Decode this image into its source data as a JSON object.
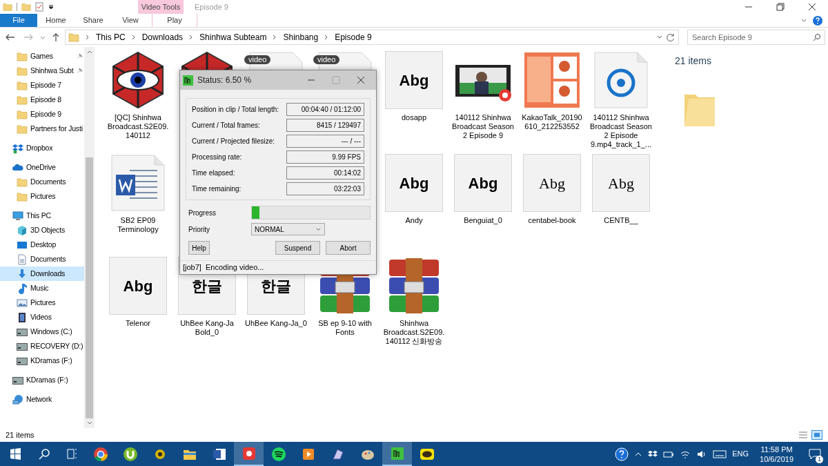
{
  "window": {
    "title": "Episode 9",
    "context_tab_group": "Video Tools"
  },
  "ribbon_tabs": [
    {
      "label": "File",
      "selected": true,
      "kind": "file"
    },
    {
      "label": "Home",
      "selected": false,
      "kind": "tab"
    },
    {
      "label": "Share",
      "selected": false,
      "kind": "tab"
    },
    {
      "label": "View",
      "selected": false,
      "kind": "tab"
    },
    {
      "label": "Play",
      "selected": false,
      "kind": "context"
    }
  ],
  "address_bar": {
    "path": [
      "This PC",
      "Downloads",
      "Shinhwa Subteam",
      "Shinbang",
      "Episode 9"
    ]
  },
  "search": {
    "placeholder": "Search Episode 9"
  },
  "sidebar": {
    "quick_access": [
      {
        "label": "Games",
        "pinned": true
      },
      {
        "label": "Shinhwa Subt",
        "pinned": true
      },
      {
        "label": "Episode 7",
        "pinned": false
      },
      {
        "label": "Episode 8",
        "pinned": false
      },
      {
        "label": "Episode 9",
        "pinned": false
      },
      {
        "label": "Partners for Justi",
        "pinned": false
      }
    ],
    "items": [
      {
        "label": "Dropbox",
        "kind": "dropbox",
        "selected": false
      },
      {
        "label": "OneDrive",
        "kind": "cloud",
        "selected": false,
        "children": [
          {
            "label": "Documents",
            "kind": "folder",
            "selected": false
          },
          {
            "label": "Pictures",
            "kind": "folder",
            "selected": false
          }
        ]
      },
      {
        "label": "This PC",
        "kind": "pc",
        "selected": false,
        "children": [
          {
            "label": "3D Objects",
            "kind": "cube",
            "selected": false
          },
          {
            "label": "Desktop",
            "kind": "desktop",
            "selected": false
          },
          {
            "label": "Documents",
            "kind": "document",
            "selected": false
          },
          {
            "label": "Downloads",
            "kind": "download",
            "selected": true
          },
          {
            "label": "Music",
            "kind": "music",
            "selected": false
          },
          {
            "label": "Pictures",
            "kind": "pictures",
            "selected": false
          },
          {
            "label": "Videos",
            "kind": "videos",
            "selected": false
          },
          {
            "label": "Windows (C:)",
            "kind": "drive",
            "selected": false
          },
          {
            "label": "RECOVERY (D:)",
            "kind": "drive",
            "selected": false
          },
          {
            "label": "KDramas (F:)",
            "kind": "drive",
            "selected": false
          }
        ]
      },
      {
        "label": "KDramas (F:)",
        "kind": "drive",
        "selected": false
      },
      {
        "label": "Network",
        "kind": "network",
        "selected": false
      }
    ]
  },
  "files": [
    {
      "kind": "eye",
      "name": "[QC] Shinhwa Broadcast.S2E09. 140112"
    },
    {
      "kind": "eye"
    },
    {
      "kind": "video",
      "badge": "video"
    },
    {
      "kind": "video",
      "badge": "video"
    },
    {
      "kind": "font",
      "preview": "Abg",
      "name": "dosapp"
    },
    {
      "kind": "thumbvideo",
      "name": "140112 Shinhwa Broadcast Season 2 Episode 9"
    },
    {
      "kind": "photo",
      "name": "KakaoTalk_20190610_212253552"
    },
    {
      "kind": "audio",
      "name": "140112 Shinhwa Broadcast Season 2 Episode 9.mp4_track_1_..."
    },
    {
      "kind": "word",
      "name": "SB2 EP09 Terminology"
    },
    {
      "kind": "covered"
    },
    {
      "kind": "covered"
    },
    {
      "kind": "covered"
    },
    {
      "kind": "font",
      "preview": "Abg",
      "name": "Andy"
    },
    {
      "kind": "font",
      "preview": "Abg",
      "name": "Benguiat_0"
    },
    {
      "kind": "fontserif",
      "preview": "Abg",
      "name": "centabel-book"
    },
    {
      "kind": "fontserif",
      "preview": "Abg",
      "name": "CENTB__"
    },
    {
      "kind": "font",
      "preview": "Abg",
      "name": "Telenor"
    },
    {
      "kind": "font",
      "preview": "한글",
      "name": "UhBee Kang-Ja Bold_0"
    },
    {
      "kind": "font",
      "preview": "한글",
      "name": "UhBee Kang-Ja_0"
    },
    {
      "kind": "rar",
      "name": "SB ep 9-10 with Fonts"
    },
    {
      "kind": "rar",
      "name": "Shinhwa Broadcast.S2E09. 140112 신화방송"
    }
  ],
  "details_pane": {
    "count": "21 items"
  },
  "status_bar": {
    "count": "21 items"
  },
  "dialog": {
    "title": "Status: 6.50 %",
    "fields": [
      {
        "label": "Position in clip / Total length:",
        "value": "00:04:40 / 01:12:00"
      },
      {
        "label": "Current / Total frames:",
        "value": "8415 / 129497"
      },
      {
        "label": "Current / Projected filesize:",
        "value": "--- / ---"
      },
      {
        "label": "Processing rate:",
        "value": "9.99 FPS"
      },
      {
        "label": "Time elapsed:",
        "value": "00:14:02"
      },
      {
        "label": "Time remaining:",
        "value": "03:22:03"
      }
    ],
    "progress_label": "Progress",
    "progress": {
      "level": 0.065
    },
    "priority_label": "Priority",
    "priority": "NORMAL",
    "buttons": [
      "Help",
      "Suspend",
      "Abort"
    ],
    "status": "[job7]  Encoding video..."
  },
  "taskbar": {
    "apps": [
      {
        "kind": "chrome",
        "active": false
      },
      {
        "kind": "torrent",
        "active": false
      },
      {
        "kind": "gear",
        "active": false
      },
      {
        "kind": "explorer",
        "active": false
      },
      {
        "kind": "word",
        "active": false
      },
      {
        "kind": "recorder",
        "active": true
      },
      {
        "kind": "spotify",
        "active": false
      },
      {
        "kind": "player",
        "active": false
      },
      {
        "kind": "paint",
        "active": false
      },
      {
        "kind": "palette",
        "active": false
      },
      {
        "kind": "encoder",
        "active": true
      },
      {
        "kind": "talk",
        "active": false
      }
    ],
    "language": "ENG",
    "time": "11:58 PM",
    "date": "10/6/2019",
    "notifications": "1"
  }
}
